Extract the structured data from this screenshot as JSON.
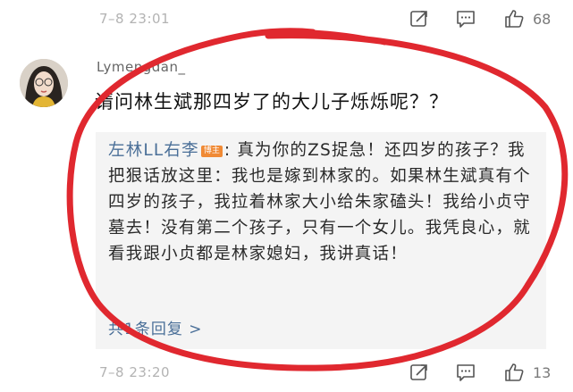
{
  "top_meta": {
    "timestamp": "7–8 23:01",
    "like_count": "68"
  },
  "comment": {
    "username": "Lymengdan_",
    "text": "请问林生斌那四岁了的大儿子烁烁呢？？"
  },
  "reply": {
    "author": "左林LL右李",
    "badge": "博主",
    "body": ": 真为你的ZS捉急！还四岁的孩子？我把狠话放这里：我也是嫁到林家的。如果林生斌真有个四岁的孩子，我拉着林家大小给朱家磕头！我给小贞守墓去！没有第二个孩子，只有一个女儿。我凭良心，就看我跟小贞都是林家媳妇，我讲真话！",
    "count_label": "共1条回复 >"
  },
  "bottom_meta": {
    "timestamp": "7–8 23:20",
    "like_count": "13"
  },
  "icons": [
    "share-icon",
    "comment-icon",
    "thumbs-up-icon"
  ],
  "colors": {
    "link": "#4a6f98",
    "badge": "#f08a35",
    "annotation_circle": "#e0282f",
    "reply_bg": "#f4f4f4"
  }
}
